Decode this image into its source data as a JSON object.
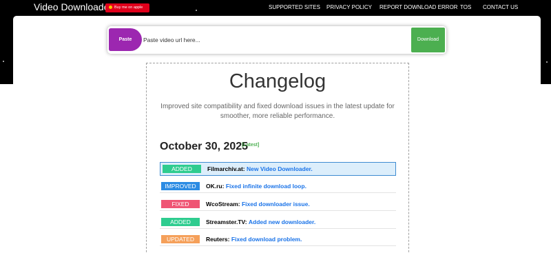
{
  "nav": {
    "brand": "Video Downloader",
    "donate_label": "Buy me on apple",
    "links": [
      "SUPPORTED SITES",
      "PRIVACY POLICY",
      "REPORT DOWNLOAD ERROR",
      "TOS",
      "CONTACT US"
    ]
  },
  "search": {
    "paste_label": "Paste",
    "placeholder": "Paste video url here...",
    "download_label": "Download"
  },
  "changelog": {
    "title": "Changelog",
    "description": "Improved site compatibility and fixed download issues in the latest update for smoother, more reliable performance.",
    "date": "October 30, 2025",
    "latest_tag": "[Latest]",
    "entries": [
      {
        "type": "ADDED",
        "site": "Filmarchiv.at:",
        "message": "New Video Downloader."
      },
      {
        "type": "IMPROVED",
        "site": "OK.ru:",
        "message": "Fixed infinite download loop."
      },
      {
        "type": "FIXED",
        "site": "WcoStream:",
        "message": "Fixed downloader issue."
      },
      {
        "type": "ADDED",
        "site": "Streamster.TV:",
        "message": "Added new downloader."
      },
      {
        "type": "UPDATED",
        "site": "Reuters:",
        "message": "Fixed download problem."
      }
    ]
  },
  "colors": {
    "ADDED": "#2ecc8f",
    "IMPROVED": "#2b8be3",
    "FIXED": "#ef5574",
    "UPDATED": "#f5a05a",
    "paste_button": "#9c27b0",
    "download_button": "#4caf50",
    "link_text": "#1a73e8"
  }
}
